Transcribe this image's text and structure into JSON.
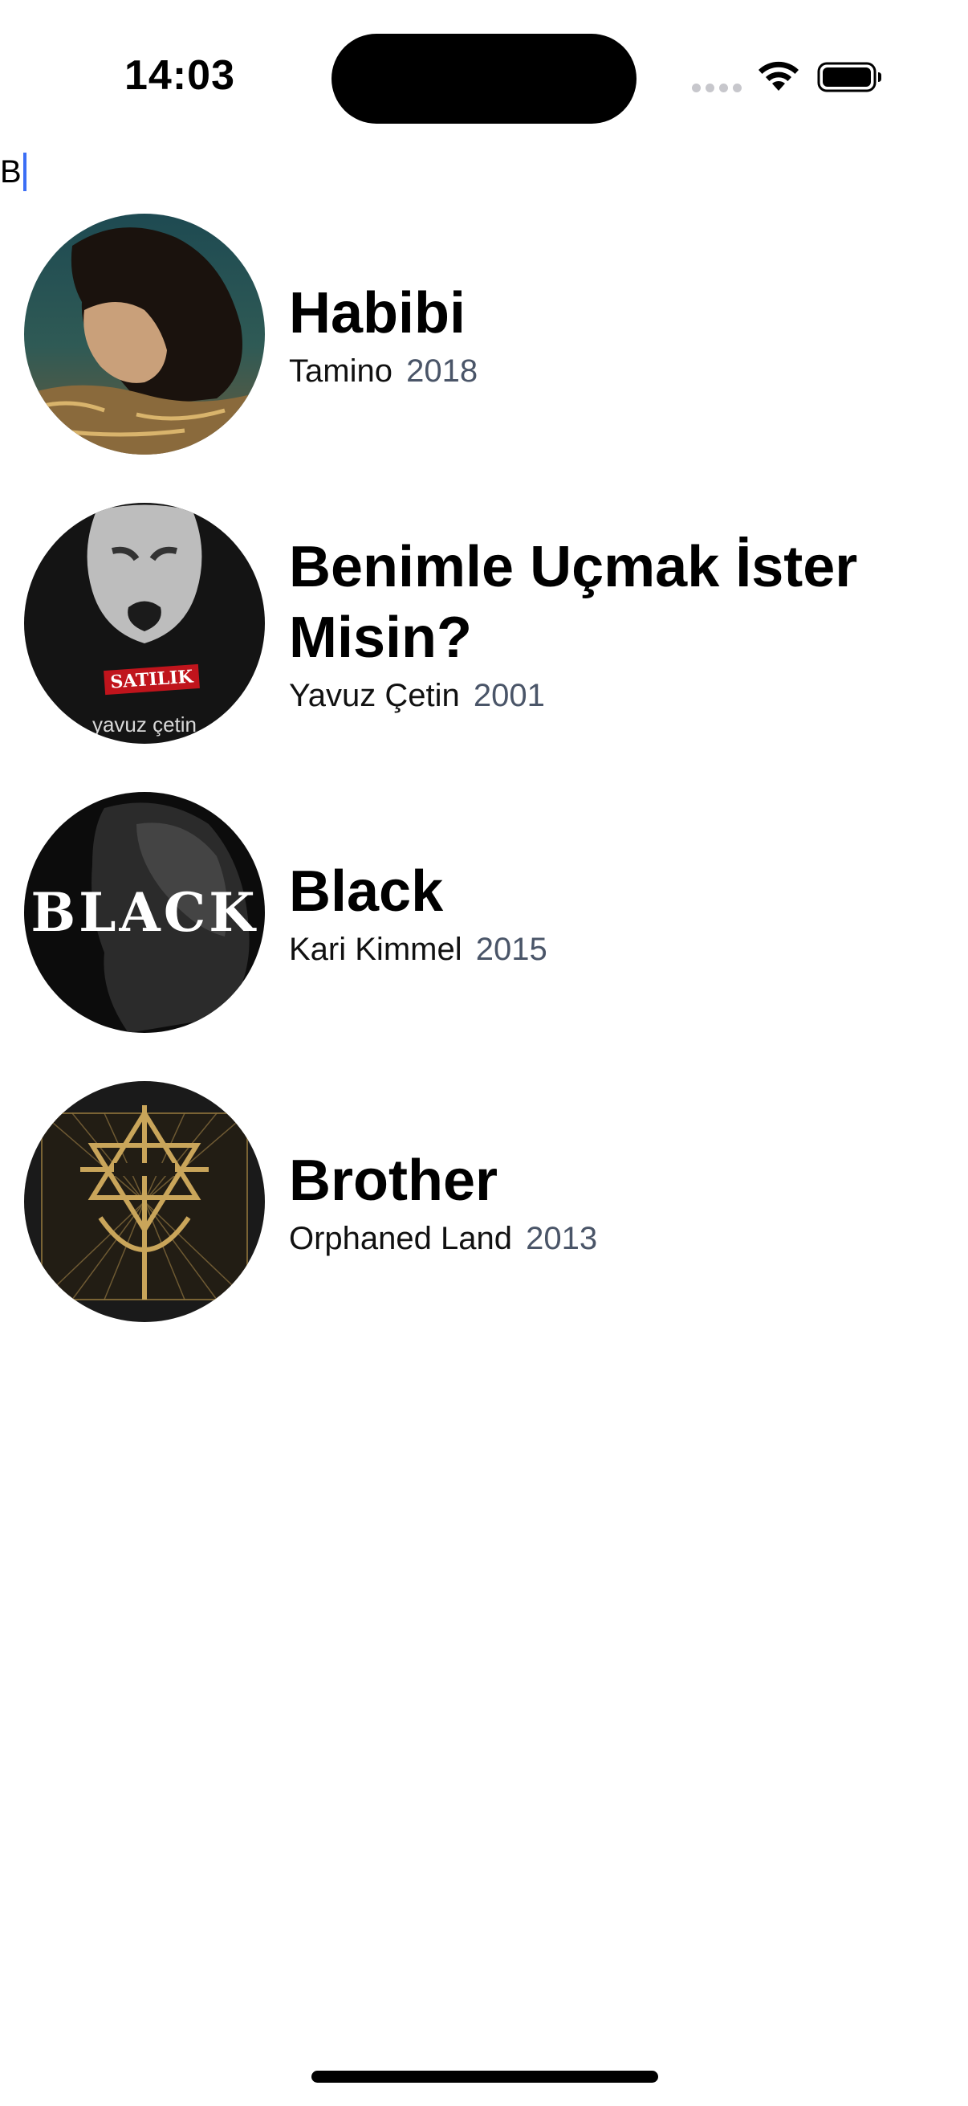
{
  "status_bar": {
    "time": "14:03"
  },
  "search": {
    "value": "B"
  },
  "songs": [
    {
      "title": "Habibi",
      "artist": "Tamino",
      "year": "2018",
      "artwork_icon": "album-art-photo"
    },
    {
      "title": "Benimle Uçmak İster Misin?",
      "artist": "Yavuz Çetin",
      "year": "2001",
      "artwork_icon": "album-art-photo",
      "artwork_text": [
        "SATILIK",
        "yavuz çetin"
      ]
    },
    {
      "title": "Black",
      "artist": "Kari Kimmel",
      "year": "2015",
      "artwork_icon": "album-art-photo",
      "artwork_text": [
        "BLACK"
      ]
    },
    {
      "title": "Brother",
      "artist": "Orphaned Land",
      "year": "2013",
      "artwork_icon": "album-art-emblem"
    }
  ],
  "colors": {
    "caret": "#3b6ef5",
    "year_text": "#4a5568",
    "background": "#ffffff"
  }
}
